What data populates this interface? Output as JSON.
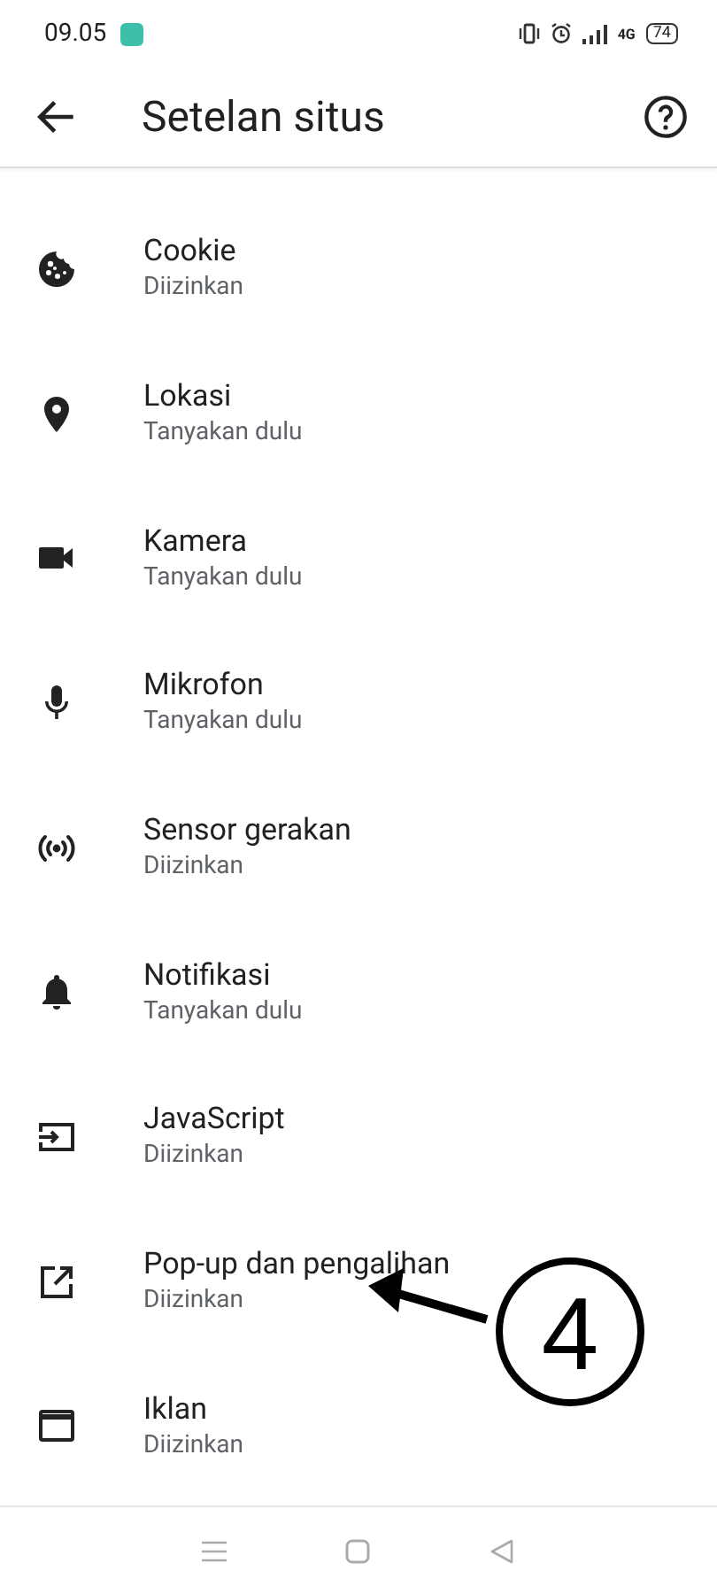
{
  "status_bar": {
    "time": "09.05",
    "battery": "74",
    "network": "4G"
  },
  "app_bar": {
    "title": "Setelan situs"
  },
  "settings": [
    {
      "title": "Cookie",
      "status": "Diizinkan"
    },
    {
      "title": "Lokasi",
      "status": "Tanyakan dulu"
    },
    {
      "title": "Kamera",
      "status": "Tanyakan dulu"
    },
    {
      "title": "Mikrofon",
      "status": "Tanyakan dulu"
    },
    {
      "title": "Sensor gerakan",
      "status": "Diizinkan"
    },
    {
      "title": "Notifikasi",
      "status": "Tanyakan dulu"
    },
    {
      "title": "JavaScript",
      "status": "Diizinkan"
    },
    {
      "title": "Pop-up dan pengalihan",
      "status": "Diizinkan"
    },
    {
      "title": "Iklan",
      "status": "Diizinkan"
    }
  ],
  "annotation": {
    "label": "4"
  }
}
